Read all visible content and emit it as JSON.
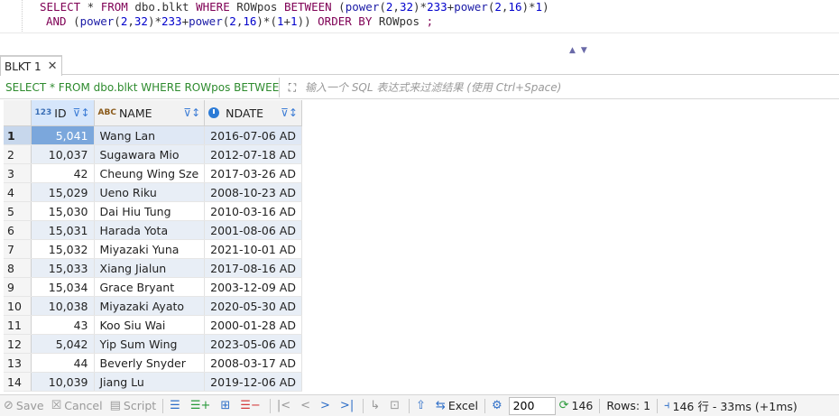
{
  "editor": {
    "line1": {
      "t1": "SELECT",
      "t2": " * ",
      "t3": "FROM",
      "t4": " dbo.blkt ",
      "t5": "WHERE",
      "t6": " ROWpos ",
      "t7": "BETWEEN",
      "t8": " (",
      "t9": "power",
      "t10": "(",
      "t11": "2",
      "t12": ",",
      "t13": "32",
      "t14": ")*",
      "t15": "233",
      "t16": "+",
      "t17": "power",
      "t18": "(",
      "t19": "2",
      "t20": ",",
      "t21": "16",
      "t22": ")*",
      "t23": "1",
      "t24": ")"
    },
    "line2": {
      "t1": "AND",
      "t2": " (",
      "t3": "power",
      "t4": "(",
      "t5": "2",
      "t6": ",",
      "t7": "32",
      "t8": ")*",
      "t9": "233",
      "t10": "+",
      "t11": "power",
      "t12": "(",
      "t13": "2",
      "t14": ",",
      "t15": "16",
      "t16": ")*(",
      "t17": "1",
      "t18": "+",
      "t19": "1",
      "t20": ")) ",
      "t21": "ORDER BY",
      "t22": " ROWpos ",
      "t23": ";"
    }
  },
  "tab": {
    "label": "BLKT 1",
    "close": "✕"
  },
  "filter": {
    "query_text": "SELECT * FROM dbo.blkt WHERE ROWpos BETWEEN",
    "placeholder": "输入一个 SQL 表达式来过滤结果 (使用 Ctrl+Space)"
  },
  "grid": {
    "columns": [
      {
        "type": "123",
        "label": "ID"
      },
      {
        "type": "ABC",
        "label": "NAME"
      },
      {
        "type": "date",
        "label": "NDATE"
      }
    ],
    "rows": [
      {
        "n": "1",
        "id": "5,041",
        "name": "Wang Lan",
        "date": "2016-07-06 AD"
      },
      {
        "n": "2",
        "id": "10,037",
        "name": "Sugawara Mio",
        "date": "2012-07-18 AD"
      },
      {
        "n": "3",
        "id": "42",
        "name": "Cheung Wing Sze",
        "date": "2017-03-26 AD"
      },
      {
        "n": "4",
        "id": "15,029",
        "name": "Ueno Riku",
        "date": "2008-10-23 AD"
      },
      {
        "n": "5",
        "id": "15,030",
        "name": "Dai Hiu Tung",
        "date": "2010-03-16 AD"
      },
      {
        "n": "6",
        "id": "15,031",
        "name": "Harada Yota",
        "date": "2001-08-06 AD"
      },
      {
        "n": "7",
        "id": "15,032",
        "name": "Miyazaki Yuna",
        "date": "2021-10-01 AD"
      },
      {
        "n": "8",
        "id": "15,033",
        "name": "Xiang Jialun",
        "date": "2017-08-16 AD"
      },
      {
        "n": "9",
        "id": "15,034",
        "name": "Grace Bryant",
        "date": "2003-12-09 AD"
      },
      {
        "n": "10",
        "id": "10,038",
        "name": "Miyazaki Ayato",
        "date": "2020-05-30 AD"
      },
      {
        "n": "11",
        "id": "43",
        "name": "Koo Siu Wai",
        "date": "2000-01-28 AD"
      },
      {
        "n": "12",
        "id": "5,042",
        "name": "Yip Sum Wing",
        "date": "2023-05-06 AD"
      },
      {
        "n": "13",
        "id": "44",
        "name": "Beverly Snyder",
        "date": "2008-03-17 AD"
      },
      {
        "n": "14",
        "id": "10,039",
        "name": "Jiang Lu",
        "date": "2019-12-06 AD"
      }
    ]
  },
  "toolbar": {
    "save": "Save",
    "cancel": "Cancel",
    "script": "Script",
    "excel": "Excel",
    "fetch_size": "200",
    "refresh_count": "146",
    "rows_label": "Rows: 1",
    "status": "146 行 - 33ms (+1ms)"
  },
  "colors": {
    "keyword": "#7f0055",
    "function": "#1a1aa6",
    "number": "#0000cc",
    "filter_text": "#2e8b2e",
    "selection": "#7ba7dc"
  }
}
